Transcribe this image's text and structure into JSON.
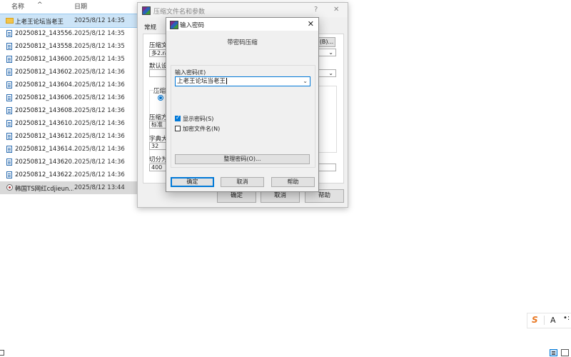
{
  "explorer": {
    "col_name": "名称",
    "col_date": "日期",
    "sort_indicator": "^",
    "rows": [
      {
        "name": "上老王论坛当老王",
        "date": "2025/8/12 14:35",
        "icon": "folder-icon",
        "selected": true
      },
      {
        "name": "20250812_143556...",
        "date": "2025/8/12 14:35",
        "icon": "document-icon"
      },
      {
        "name": "20250812_143558...",
        "date": "2025/8/12 14:35",
        "icon": "document-icon"
      },
      {
        "name": "20250812_143600...",
        "date": "2025/8/12 14:35",
        "icon": "document-icon"
      },
      {
        "name": "20250812_143602...",
        "date": "2025/8/12 14:36",
        "icon": "document-icon"
      },
      {
        "name": "20250812_143604...",
        "date": "2025/8/12 14:36",
        "icon": "document-icon"
      },
      {
        "name": "20250812_143606...",
        "date": "2025/8/12 14:36",
        "icon": "document-icon"
      },
      {
        "name": "20250812_143608...",
        "date": "2025/8/12 14:36",
        "icon": "document-icon"
      },
      {
        "name": "20250812_143610...",
        "date": "2025/8/12 14:36",
        "icon": "document-icon"
      },
      {
        "name": "20250812_143612...",
        "date": "2025/8/12 14:36",
        "icon": "document-icon"
      },
      {
        "name": "20250812_143614...",
        "date": "2025/8/12 14:36",
        "icon": "document-icon"
      },
      {
        "name": "20250812_143620...",
        "date": "2025/8/12 14:36",
        "icon": "document-icon"
      },
      {
        "name": "20250812_143622...",
        "date": "2025/8/12 14:36",
        "icon": "document-icon"
      },
      {
        "name": "韩国TS网红cdjieun...",
        "date": "2025/8/12 13:44",
        "icon": "rar-archive-icon"
      }
    ]
  },
  "archive_window": {
    "title": "压缩文件名和参数",
    "help_glyph": "?",
    "close_glyph": "✕",
    "tab_general": "常规",
    "archive_name_label": "压缩文",
    "archive_name_value": "多2.ra",
    "browse_label": "(B)...",
    "default_profile_label": "默认设",
    "format_group_label": "压缩",
    "method_label": "压缩方",
    "method_value": "标准",
    "dict_label": "字典大",
    "dict_value": "32",
    "split_label": "切分为",
    "split_value": "400",
    "ok": "确定",
    "cancel": "取消",
    "help": "帮助"
  },
  "password_dialog": {
    "title": "输入密码",
    "close_glyph": "✕",
    "heading": "带密码压缩",
    "password_label": "输入密码(E)",
    "password_value": "上老王论坛当老王",
    "show_password_label": "显示密码(S)",
    "show_password_checked": true,
    "encrypt_names_label": "加密文件名(N)",
    "encrypt_names_checked": false,
    "organize_button": "整理密码(O)...",
    "ok": "确定",
    "cancel": "取消",
    "help": "帮助"
  },
  "ime_toolbar": {
    "logo": "S",
    "mode": "A",
    "dots": "•:"
  },
  "colors": {
    "selection": "#cce4f7",
    "accent": "#0078d7",
    "ime_orange": "#e87722"
  }
}
